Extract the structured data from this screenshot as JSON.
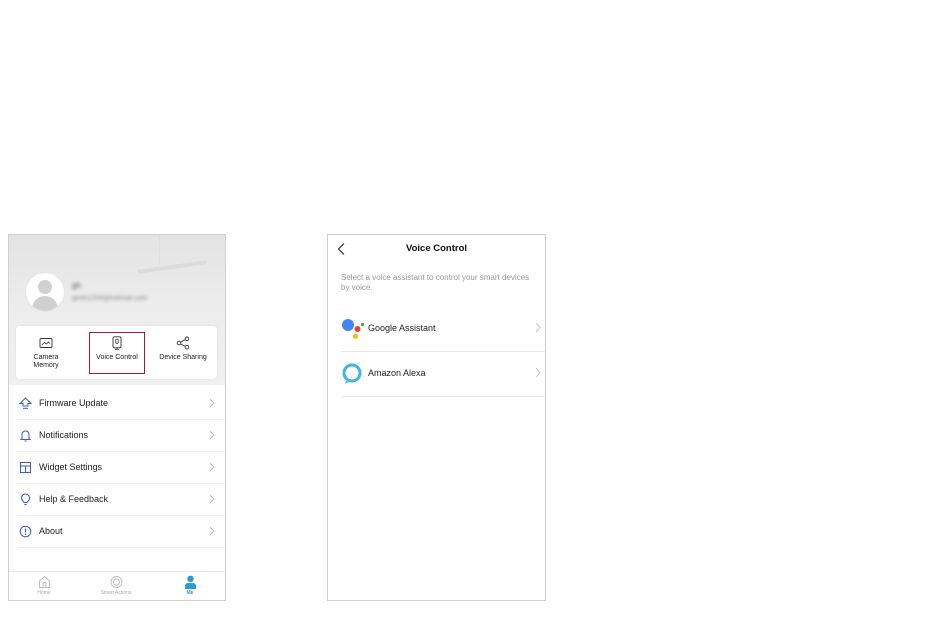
{
  "left_screen": {
    "profile": {
      "username": "gh",
      "email": "gexh1234@hotmail.com"
    },
    "quick_actions": [
      {
        "label": "Camera\nMemory",
        "icon": "camera-memory-icon"
      },
      {
        "label": "Voice Control",
        "icon": "microphone-icon"
      },
      {
        "label": "Device Sharing",
        "icon": "share-icon"
      }
    ],
    "highlight_color": "#a01c2c",
    "menu": [
      {
        "label": "Firmware Update",
        "icon": "firmware-update-icon"
      },
      {
        "label": "Notifications",
        "icon": "bell-icon"
      },
      {
        "label": "Widget Settings",
        "icon": "widget-icon"
      },
      {
        "label": "Help & Feedback",
        "icon": "lightbulb-icon"
      },
      {
        "label": "About",
        "icon": "info-icon"
      }
    ],
    "tabs": [
      {
        "label": "Home",
        "icon": "home-icon",
        "active": false
      },
      {
        "label": "Smart Actions",
        "icon": "smart-actions-icon",
        "active": false
      },
      {
        "label": "Me",
        "icon": "person-icon",
        "active": true
      }
    ],
    "accent_color": "#2b9bd8"
  },
  "right_screen": {
    "title": "Voice Control",
    "description": "Select a voice assistant to control your smart devices by voice.",
    "assistants": [
      {
        "label": "Google Assistant",
        "icon": "google-assistant-icon"
      },
      {
        "label": "Amazon Alexa",
        "icon": "amazon-alexa-icon"
      }
    ]
  }
}
